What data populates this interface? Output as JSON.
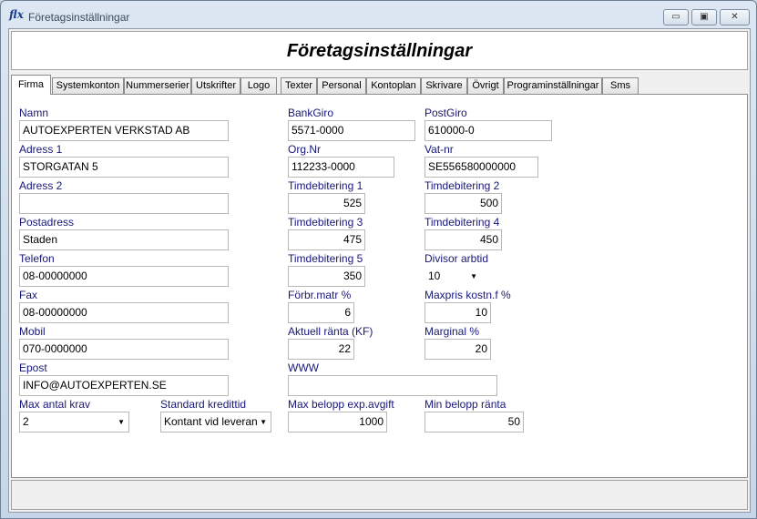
{
  "window": {
    "title": "Företagsinställningar",
    "icon_text": "f",
    "icon_text2": "lx",
    "min_symbol": "▭",
    "max_symbol": "▣",
    "close_symbol": "✕"
  },
  "header": {
    "title": "Företagsinställningar"
  },
  "tabs": [
    {
      "label": "Firma"
    },
    {
      "label": "Systemkonton"
    },
    {
      "label": "Nummerserier"
    },
    {
      "label": "Utskrifter"
    },
    {
      "label": "Logo"
    },
    {
      "label": "Texter"
    },
    {
      "label": "Personal"
    },
    {
      "label": "Kontoplan"
    },
    {
      "label": "Skrivare"
    },
    {
      "label": "Övrigt"
    },
    {
      "label": "Programinställningar"
    },
    {
      "label": "Sms"
    }
  ],
  "fields": {
    "namn": {
      "label": "Namn",
      "value": "AUTOEXPERTEN VERKSTAD AB"
    },
    "adress1": {
      "label": "Adress 1",
      "value": "STORGATAN 5"
    },
    "adress2": {
      "label": "Adress 2",
      "value": ""
    },
    "postadress": {
      "label": "Postadress",
      "value": "Staden"
    },
    "telefon": {
      "label": "Telefon",
      "value": "08-00000000"
    },
    "fax": {
      "label": "Fax",
      "value": "08-00000000"
    },
    "mobil": {
      "label": "Mobil",
      "value": "070-0000000"
    },
    "epost": {
      "label": "Epost",
      "value": "INFO@AUTOEXPERTEN.SE"
    },
    "max_antal_krav": {
      "label": "Max antal krav",
      "value": "2"
    },
    "standard_kredittid": {
      "label": "Standard kredittid",
      "value": "Kontant vid leverans"
    },
    "bankgiro": {
      "label": "BankGiro",
      "value": "5571-0000"
    },
    "orgnr": {
      "label": "Org.Nr",
      "value": "112233-0000"
    },
    "timdeb1": {
      "label": "Timdebitering 1",
      "value": "525"
    },
    "timdeb3": {
      "label": "Timdebitering 3",
      "value": "475"
    },
    "timdeb5": {
      "label": "Timdebitering 5",
      "value": "350"
    },
    "forbr_matr": {
      "label": "Förbr.matr %",
      "value": "6"
    },
    "aktuell_ranta": {
      "label": "Aktuell ränta (KF)",
      "value": "22"
    },
    "www": {
      "label": "WWW",
      "value": ""
    },
    "max_belopp": {
      "label": "Max belopp exp.avgift",
      "value": "1000"
    },
    "postgiro": {
      "label": "PostGiro",
      "value": "610000-0"
    },
    "vatnr": {
      "label": "Vat-nr",
      "value": "SE556580000000"
    },
    "timdeb2": {
      "label": "Timdebitering 2",
      "value": "500"
    },
    "timdeb4": {
      "label": "Timdebitering 4",
      "value": "450"
    },
    "divisor": {
      "label": "Divisor arbtid",
      "value": "10"
    },
    "maxpris": {
      "label": "Maxpris kostn.f %",
      "value": "10"
    },
    "marginal": {
      "label": "Marginal %",
      "value": "20"
    },
    "min_belopp": {
      "label": "Min belopp ränta",
      "value": "50"
    }
  },
  "icons": {
    "dropdown_arrow": "▼"
  },
  "colors": {
    "label_text": "#17177a"
  }
}
